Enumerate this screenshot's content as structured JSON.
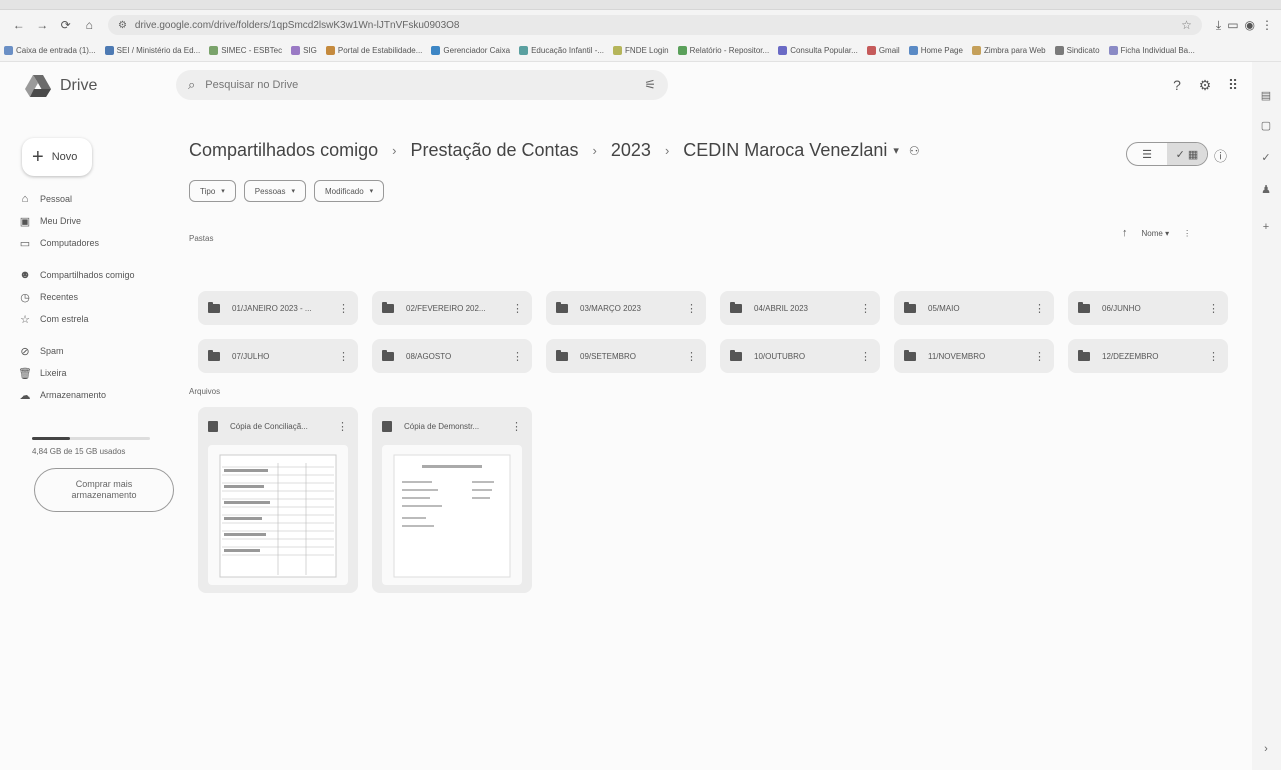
{
  "browser": {
    "url": "drive.google.com/drive/folders/1qpSmcd2lswK3w1Wn-lJTnVFsku0903O8",
    "nav_back": "←",
    "nav_forward": "→",
    "reload": "⟳",
    "home": "⌂",
    "bookmarks": [
      {
        "label": "Caixa de entrada (1)...",
        "color": "#6a8fc5"
      },
      {
        "label": "SEI / Ministério da Ed...",
        "color": "#4d7ab3"
      },
      {
        "label": "SIMEC - ESBTec",
        "color": "#7aa36b"
      },
      {
        "label": "SIG",
        "color": "#9a7ac5"
      },
      {
        "label": "Portal de Estabilidade...",
        "color": "#c58a3d"
      },
      {
        "label": "Gerenciador Caixa",
        "color": "#3d86c5"
      },
      {
        "label": "Educação Infantil -...",
        "color": "#5aa0a0"
      },
      {
        "label": "FNDE Login",
        "color": "#b5b55a"
      },
      {
        "label": "Relatório - Repositor...",
        "color": "#5aa05a"
      },
      {
        "label": "Consulta Popular...",
        "color": "#6a6ac5"
      },
      {
        "label": "Gmail",
        "color": "#c55a5a"
      },
      {
        "label": "Home Page",
        "color": "#5a8ac5"
      },
      {
        "label": "Zimbra para Web",
        "color": "#c5a05a"
      },
      {
        "label": "Sindicato",
        "color": "#7a7a7a"
      },
      {
        "label": "Ficha Individual Ba...",
        "color": "#8a8ac5"
      }
    ]
  },
  "app": {
    "name": "Drive",
    "search_placeholder": "Pesquisar no Drive"
  },
  "sidebar": {
    "new_label": "Novo",
    "items": [
      {
        "label": "Pessoal",
        "icon": "home-icon"
      },
      {
        "label": "Meu Drive",
        "icon": "drive-icon"
      },
      {
        "label": "Computadores",
        "icon": "computer-icon"
      },
      {
        "label": "Compartilhados comigo",
        "icon": "people-icon"
      },
      {
        "label": "Recentes",
        "icon": "clock-icon"
      },
      {
        "label": "Com estrela",
        "icon": "star-icon"
      },
      {
        "label": "Spam",
        "icon": "spam-icon"
      },
      {
        "label": "Lixeira",
        "icon": "trash-icon"
      },
      {
        "label": "Armazenamento",
        "icon": "cloud-icon"
      }
    ],
    "storage_used_fraction": 0.32,
    "storage_text": "4,84 GB de 15 GB usados",
    "buy_storage": "Comprar mais armazenamento"
  },
  "breadcrumb": [
    "Compartilhados comigo",
    "Prestação de Contas",
    "2023",
    "CEDIN Maroca Venezlani"
  ],
  "filters": [
    {
      "label": "Tipo"
    },
    {
      "label": "Pessoas"
    },
    {
      "label": "Modificado"
    }
  ],
  "sections": {
    "folders": "Pastas",
    "files": "Arquivos"
  },
  "sort": {
    "label": "Nome",
    "arrow": "↑"
  },
  "folders": [
    "01/JANEIRO 2023 - ...",
    "02/FEVEREIRO 202...",
    "03/MARÇO 2023",
    "04/ABRIL 2023",
    "05/MAIO",
    "06/JUNHO",
    "07/JULHO",
    "08/AGOSTO",
    "09/SETEMBRO",
    "10/OUTUBRO",
    "11/NOVEMBRO",
    "12/DEZEMBRO"
  ],
  "files": [
    "Cópia de Conciliaçã...",
    "Cópia de Demonstr..."
  ]
}
